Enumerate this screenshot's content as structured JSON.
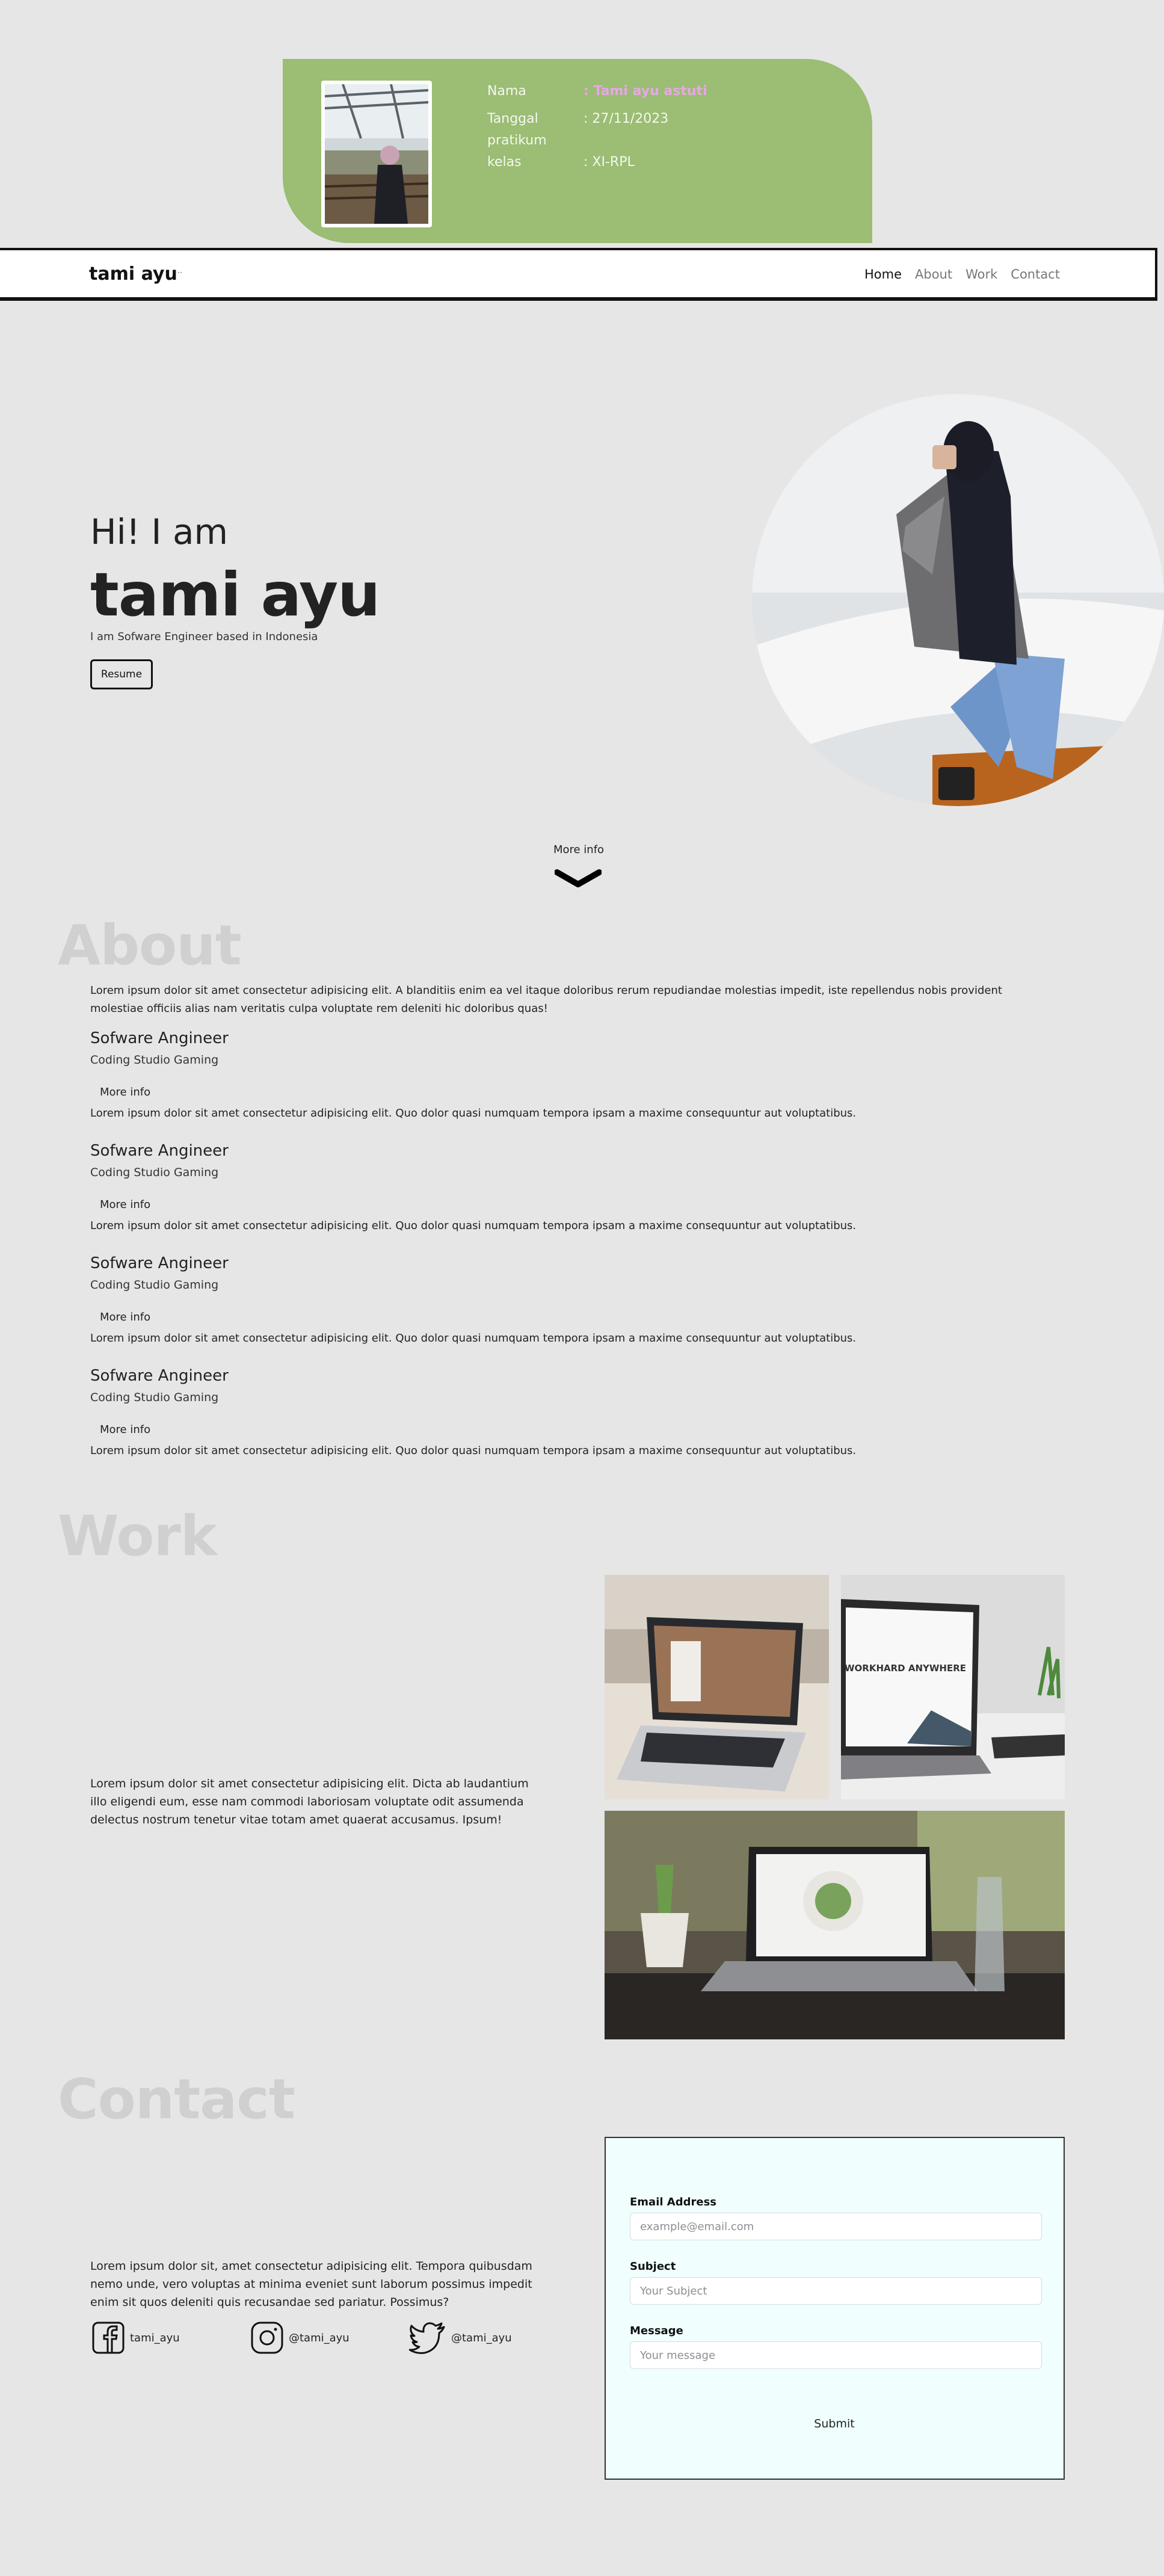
{
  "profile": {
    "rows": [
      {
        "label": "Nama",
        "value": ": Tami ayu astuti"
      },
      {
        "label": "Tanggal pratikum",
        "value": ": 27/11/2023"
      },
      {
        "label": "kelas",
        "value": ": XI-RPL"
      }
    ]
  },
  "navbar": {
    "brand": "tami ayu",
    "toggle": "···",
    "links": [
      "Home",
      "About",
      "Work",
      "Contact"
    ]
  },
  "hero": {
    "greeting": "Hi! I am",
    "name": "tami ayu",
    "subtitle": "I am Sofware Engineer based in Indonesia",
    "resume_label": "Resume",
    "more_info": "More info"
  },
  "about": {
    "title": "About",
    "intro": "Lorem ipsum dolor sit amet consectetur adipisicing elit. A blanditiis enim ea vel itaque doloribus rerum repudiandae molestias impedit, iste repellendus nobis provident molestiae officiis alias nam veritatis culpa voluptate rem deleniti hic doloribus quas!",
    "jobs": [
      {
        "title": "Sofware Angineer",
        "company": "Coding Studio Gaming",
        "more": "More info",
        "desc": "Lorem ipsum dolor sit amet consectetur adipisicing elit. Quo dolor quasi numquam tempora ipsam a maxime consequuntur aut voluptatibus."
      },
      {
        "title": "Sofware Angineer",
        "company": "Coding Studio Gaming",
        "more": "More info",
        "desc": "Lorem ipsum dolor sit amet consectetur adipisicing elit. Quo dolor quasi numquam tempora ipsam a maxime consequuntur aut voluptatibus."
      },
      {
        "title": "Sofware Angineer",
        "company": "Coding Studio Gaming",
        "more": "More info",
        "desc": "Lorem ipsum dolor sit amet consectetur adipisicing elit. Quo dolor quasi numquam tempora ipsam a maxime consequuntur aut voluptatibus."
      },
      {
        "title": "Sofware Angineer",
        "company": "Coding Studio Gaming",
        "more": "More info",
        "desc": "Lorem ipsum dolor sit amet consectetur adipisicing elit. Quo dolor quasi numquam tempora ipsam a maxime consequuntur aut voluptatibus."
      }
    ]
  },
  "work": {
    "title": "Work",
    "text": "Lorem ipsum dolor sit amet consectetur adipisicing elit. Dicta ab laudantium illo eligendi eum, esse nam commodi laboriosam voluptate odit assumenda delectus nostrum tenetur vitae totam amet quaerat accusamus. Ipsum!",
    "laptop_screen_text": "WORKHARD ANYWHERE"
  },
  "contact": {
    "title": "Contact",
    "text": "Lorem ipsum dolor sit, amet consectetur adipisicing elit. Tempora quibusdam nemo unde, vero voluptas at minima eveniet sunt laborum possimus impedit enim sit quos deleniti quis recusandae sed pariatur. Possimus?",
    "socials": [
      {
        "icon": "facebook-icon",
        "handle": "tami_ayu"
      },
      {
        "icon": "instagram-icon",
        "handle": "@tami_ayu"
      },
      {
        "icon": "twitter-icon",
        "handle": "@tami_ayu"
      }
    ],
    "form": {
      "email_label": "Email Address",
      "email_placeholder": "example@email.com",
      "subject_label": "Subject",
      "subject_placeholder": "Your Subject",
      "message_label": "Message",
      "message_placeholder": "Your message",
      "submit_label": "Submit"
    }
  },
  "colors": {
    "page_bg": "#e6e6e6",
    "card_green": "#9bbd74",
    "name_pink": "#e7a8e4",
    "section_title": "#d0d0d0",
    "form_bg": "#f0fffe"
  }
}
